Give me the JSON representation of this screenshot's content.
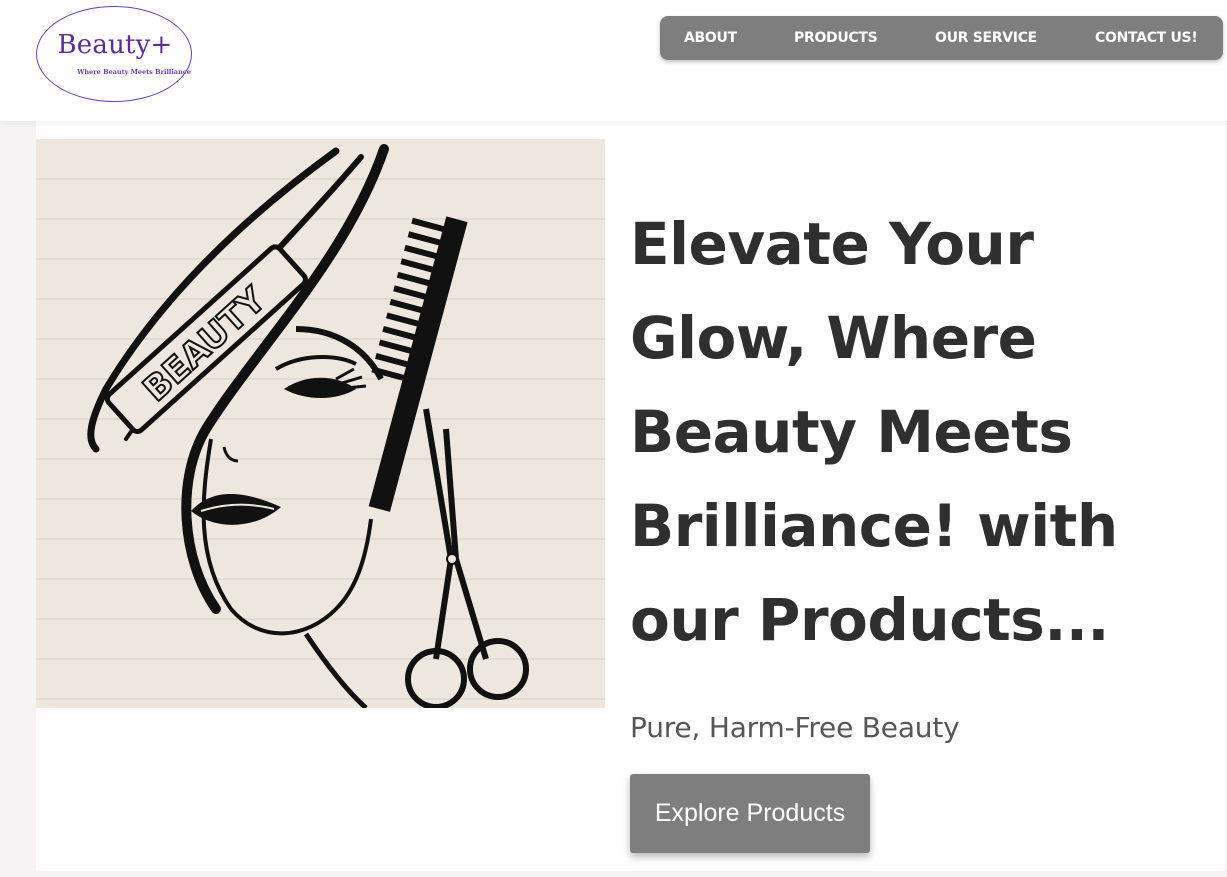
{
  "brand": {
    "name": "Beauty+",
    "tagline": "Where Beauty Meets Brilliance",
    "accent_color": "#5b2d9a"
  },
  "nav": {
    "background_color": "#7e7e7e",
    "items": [
      {
        "label": "ABOUT"
      },
      {
        "label": "PRODUCTS"
      },
      {
        "label": "OUR SERVICE"
      },
      {
        "label": "CONTACT US!"
      }
    ]
  },
  "hero": {
    "image": {
      "icon": "beauty-salon-illustration",
      "band_text": "BEAUTY"
    },
    "title_lines": [
      "Elevate Your",
      "Glow, Where",
      "Beauty Meets",
      "Brilliance! with",
      "our Products..."
    ],
    "subtitle": "Pure, Harm-Free Beauty",
    "cta_label": "Explore Products"
  }
}
